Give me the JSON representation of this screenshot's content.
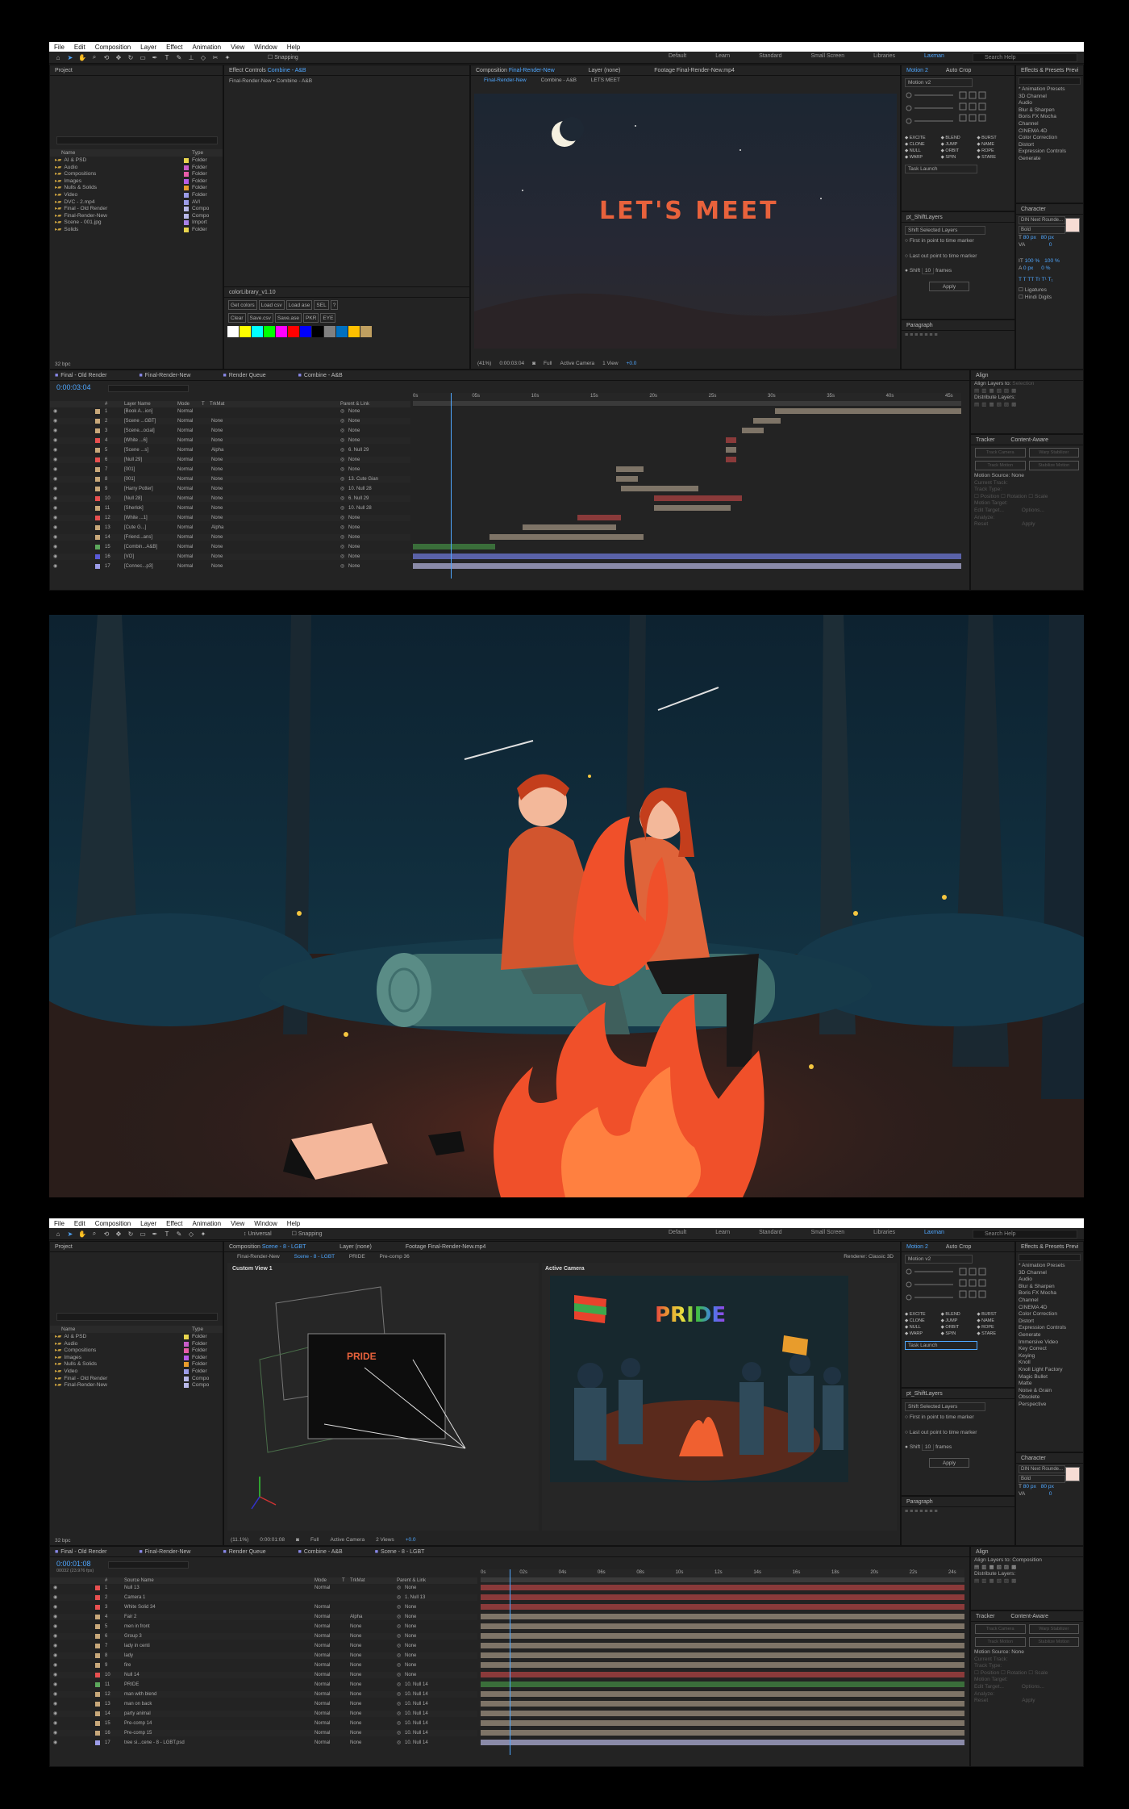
{
  "menu": [
    "File",
    "Edit",
    "Composition",
    "Layer",
    "Effect",
    "Animation",
    "View",
    "Window",
    "Help"
  ],
  "workspaces": [
    "Default",
    "Learn",
    "Standard",
    "Small Screen",
    "Libraries",
    "Laxman"
  ],
  "search_placeholder": "Search Help",
  "snapping": "Snapping",
  "top": {
    "project_title": "Project",
    "project_cols": [
      "Name",
      "Type"
    ],
    "project_items": [
      {
        "name": "AI & PSD",
        "type": "Folder",
        "color": "#e8d44d"
      },
      {
        "name": "Audio",
        "type": "Folder",
        "color": "#c85cc8"
      },
      {
        "name": "Compositions",
        "type": "Folder",
        "color": "#e85ca8"
      },
      {
        "name": "Images",
        "type": "Folder",
        "color": "#b85ce8"
      },
      {
        "name": "Nulls & Solids",
        "type": "Folder",
        "color": "#e89c2c"
      },
      {
        "name": "Video",
        "type": "Folder",
        "color": "#9c9ce8"
      },
      {
        "name": "DVC - 2.mp4",
        "type": "AVI",
        "color": "#9c9ce8"
      },
      {
        "name": "Final - Old Render",
        "type": "Compo",
        "color": "#b8b8e8"
      },
      {
        "name": "Final-Render-New",
        "type": "Compo",
        "color": "#b8b8e8"
      },
      {
        "name": "Scene - 001.jpg",
        "type": "Import",
        "color": "#a880e8"
      },
      {
        "name": "Solids",
        "type": "Folder",
        "color": "#e8d44d"
      }
    ],
    "bpc": "32 bpc",
    "effect_controls_tab": "Effect Controls",
    "effect_controls_target": "Combine - A&B",
    "effect_controls_path": "Final-Render-New • Combine - A&B",
    "colorlib_title": "colorLibrary_v1.10",
    "colorlib_buttons_1": [
      "Get colors",
      "Load csv",
      "Load ase",
      "SEL",
      "?"
    ],
    "colorlib_buttons_2": [
      "Clear",
      "Save.csv",
      "Save.ase",
      "PKR",
      "EYE"
    ],
    "swatches": [
      "#ffffff",
      "#ffff00",
      "#00ffff",
      "#00ff00",
      "#ff00ff",
      "#ff0000",
      "#0000ff",
      "#000000",
      "#808080",
      "#0070c0",
      "#ffc000",
      "#c0a060"
    ],
    "comp_tab": "Composition",
    "comp_name": "Final-Render-New",
    "layer_tab": "Layer (none)",
    "footage_tab": "Footage Final-Render-New.mp4",
    "breadcrumbs": [
      "Final-Render-New",
      "Combine - A&B",
      "LETS MEET"
    ],
    "viewer_text": "LET'S MEET",
    "zoom": "(41%)",
    "timecode_small": "0:00:03:04",
    "resolution": "Full",
    "camera": "Active Camera",
    "views": "1 View",
    "exposure": "+0.0",
    "motion_tabs": [
      "Motion 2",
      "Auto Crop"
    ],
    "motion_version": "Motion v2",
    "motion_buttons": [
      "EXCITE",
      "BLEND",
      "BURST",
      "CLONE",
      "JUMP",
      "NAME",
      "NULL",
      "ORBIT",
      "ROPE",
      "WARP",
      "SPIN",
      "STARE"
    ],
    "task_launch": "Task Launch",
    "shift_title": "pt_ShiftLayers",
    "shift_mode": "Shift Selected Layers",
    "shift_opt1": "First in point to time marker",
    "shift_opt2": "Last out point to time marker",
    "shift_label": "Shift",
    "shift_value": "10",
    "shift_unit": "frames",
    "apply": "Apply",
    "paragraph": "Paragraph",
    "effects_tabs": [
      "Effects & Presets",
      "Previ"
    ],
    "effects_list": [
      "* Animation Presets",
      "3D Channel",
      "Audio",
      "Blur & Sharpen",
      "Boris FX Mocha",
      "Channel",
      "CINEMA 4D",
      "Color Correction",
      "Distort",
      "Expression Controls",
      "Generate"
    ],
    "character_title": "Character",
    "font_name": "DIN Next Rounde...",
    "font_style": "Bold",
    "font_size": "80 px",
    "leading": "80 px",
    "tracking_val": "0",
    "scale_v": "100 %",
    "scale_h": "100 %",
    "baseline": "0 px",
    "tsume": "0 %",
    "ligatures": "Ligatures",
    "hindi_digits": "Hindi Digits",
    "align_title": "Align",
    "align_layers_to": "Align Layers to:",
    "align_target": "Selection",
    "distribute": "Distribute Layers:",
    "tracker_tabs": [
      "Tracker",
      "Content-Aware"
    ],
    "tracker_buttons": [
      "Track Camera",
      "Warp Stabilizer",
      "Track Motion",
      "Stabilize Motion"
    ],
    "motion_source": "Motion Source:",
    "motion_source_val": "None",
    "current_track": "Current Track:",
    "track_type": "Track Type:",
    "track_opts": [
      "Position",
      "Rotation",
      "Scale"
    ],
    "motion_target": "Motion Target:",
    "edit_target": "Edit Target...",
    "options": "Options...",
    "analyze": "Analyze:",
    "reset": "Reset",
    "apply2": "Apply",
    "timeline_tabs": [
      "Final - Old Render",
      "Final-Render-New",
      "Render Queue",
      "Combine - A&B"
    ],
    "timecode": "0:00:03:04",
    "tl_cols": [
      "#",
      "Layer Name",
      "Mode",
      "T",
      "TrkMat",
      "Parent & Link"
    ],
    "ruler": [
      "0s",
      "05s",
      "10s",
      "15s",
      "20s",
      "25s",
      "30s",
      "35s",
      "40s",
      "45s"
    ],
    "layers": [
      {
        "n": "1",
        "name": "[Book A...ion]",
        "mode": "Normal",
        "trk": "",
        "parent": "None",
        "color": "#c8a87a"
      },
      {
        "n": "2",
        "name": "[Scene ...GBT]",
        "mode": "Normal",
        "trk": "None",
        "parent": "None",
        "color": "#c8a87a"
      },
      {
        "n": "3",
        "name": "[Scene...ocial]",
        "mode": "Normal",
        "trk": "None",
        "parent": "None",
        "color": "#c8a87a"
      },
      {
        "n": "4",
        "name": "[White ...6]",
        "mode": "Normal",
        "trk": "None",
        "parent": "None",
        "color": "#e85050"
      },
      {
        "n": "5",
        "name": "[Scene ...s]",
        "mode": "Normal",
        "trk": "Alpha",
        "parent": "6. Null 29",
        "color": "#c8a87a"
      },
      {
        "n": "6",
        "name": "[Null 29]",
        "mode": "Normal",
        "trk": "None",
        "parent": "None",
        "color": "#e85050"
      },
      {
        "n": "7",
        "name": "[001]",
        "mode": "Normal",
        "trk": "None",
        "parent": "None",
        "color": "#c8a87a"
      },
      {
        "n": "8",
        "name": "[001]",
        "mode": "Normal",
        "trk": "None",
        "parent": "13. Cute Gian",
        "color": "#c8a87a"
      },
      {
        "n": "9",
        "name": "[Harry Potter]",
        "mode": "Normal",
        "trk": "None",
        "parent": "10. Null 28",
        "color": "#c8a87a"
      },
      {
        "n": "10",
        "name": "[Null 28]",
        "mode": "Normal",
        "trk": "None",
        "parent": "6. Null 29",
        "color": "#e85050"
      },
      {
        "n": "11",
        "name": "[Sherlok]",
        "mode": "Normal",
        "trk": "None",
        "parent": "10. Null 28",
        "color": "#c8a87a"
      },
      {
        "n": "12",
        "name": "[White ...1]",
        "mode": "Normal",
        "trk": "None",
        "parent": "None",
        "color": "#e85050"
      },
      {
        "n": "13",
        "name": "[Cute G...]",
        "mode": "Normal",
        "trk": "Alpha",
        "parent": "None",
        "color": "#c8a87a"
      },
      {
        "n": "14",
        "name": "[Friend...ans]",
        "mode": "Normal",
        "trk": "None",
        "parent": "None",
        "color": "#c8a87a"
      },
      {
        "n": "15",
        "name": "[Combin...A&B]",
        "mode": "Normal",
        "trk": "None",
        "parent": "None",
        "color": "#5ca85c"
      },
      {
        "n": "16",
        "name": "[VO]",
        "mode": "Normal",
        "trk": "None",
        "parent": "None",
        "color": "#5a5ad8"
      },
      {
        "n": "17",
        "name": "[Connec...p3]",
        "mode": "Normal",
        "trk": "None",
        "parent": "None",
        "color": "#9c9ce8"
      }
    ]
  },
  "bottom": {
    "project_title": "Project",
    "project_items": [
      {
        "name": "AI & PSD",
        "type": "Folder",
        "color": "#e8d44d"
      },
      {
        "name": "Audio",
        "type": "Folder",
        "color": "#c85cc8"
      },
      {
        "name": "Compositions",
        "type": "Folder",
        "color": "#e85ca8"
      },
      {
        "name": "Images",
        "type": "Folder",
        "color": "#b85ce8"
      },
      {
        "name": "Nulls & Solids",
        "type": "Folder",
        "color": "#e89c2c"
      },
      {
        "name": "Video",
        "type": "Folder",
        "color": "#9c9ce8"
      },
      {
        "name": "Final - Old Render",
        "type": "Compo",
        "color": "#b8b8e8"
      },
      {
        "name": "Final-Render-New",
        "type": "Compo",
        "color": "#b8b8e8"
      }
    ],
    "bpc": "32 bpc",
    "comp_tab": "Composition",
    "comp_name": "Scene - 8 - LGBT",
    "layer_tab": "Layer (none)",
    "footage_tab": "Footage Final-Render-New.mp4",
    "breadcrumbs": [
      "Final-Render-New",
      "Scene - 8 - LGBT",
      "PRIDE",
      "Pre-comp 36"
    ],
    "renderer": "Renderer:",
    "renderer_val": "Classic 3D",
    "custom_view": "Custom View 1",
    "active_camera_label": "Active Camera",
    "pride": "PRIDE",
    "zoom": "(11.1%)",
    "timecode_small": "0:00:01:08",
    "resolution": "Full",
    "camera": "Active Camera",
    "views": "2 Views",
    "exposure": "+0.0",
    "universal": "Universal",
    "effects_list": [
      "* Animation Presets",
      "3D Channel",
      "Audio",
      "Blur & Sharpen",
      "Boris FX Mocha",
      "Channel",
      "CINEMA 4D",
      "Color Correction",
      "Distort",
      "Expression Controls",
      "Generate",
      "Immersive Video",
      "Key Correct",
      "Keying",
      "Knoll",
      "Knoll Light Factory",
      "Magic Bullet",
      "Matte",
      "Noise & Grain",
      "Obsolete",
      "Perspective"
    ],
    "align_target": "Composition",
    "timeline_tabs": [
      "Final - Old Render",
      "Final-Render-New",
      "Render Queue",
      "Combine - A&B",
      "Scene - 8 - LGBT"
    ],
    "timecode": "0:00:01:08",
    "frames": "00032 (23.976 fps)",
    "tl_cols": [
      "#",
      "Source Name",
      "Mode",
      "T",
      "TrkMat",
      "Parent & Link"
    ],
    "ruler": [
      "0s",
      "02s",
      "04s",
      "06s",
      "08s",
      "10s",
      "12s",
      "14s",
      "16s",
      "18s",
      "20s",
      "22s",
      "24s"
    ],
    "layers": [
      {
        "n": "1",
        "name": "Null 13",
        "mode": "Normal",
        "trk": "",
        "parent": "None",
        "color": "#e85050"
      },
      {
        "n": "2",
        "name": "Camera 1",
        "mode": "",
        "trk": "",
        "parent": "1. Null 13",
        "color": "#e85050"
      },
      {
        "n": "3",
        "name": "White Solid 34",
        "mode": "Normal",
        "trk": "",
        "parent": "None",
        "color": "#e85050"
      },
      {
        "n": "4",
        "name": "Fair 2",
        "mode": "Normal",
        "trk": "Alpha",
        "parent": "None",
        "color": "#c8a87a"
      },
      {
        "n": "5",
        "name": "men in front",
        "mode": "Normal",
        "trk": "None",
        "parent": "None",
        "color": "#c8a87a"
      },
      {
        "n": "6",
        "name": "Group 3",
        "mode": "Normal",
        "trk": "None",
        "parent": "None",
        "color": "#c8a87a"
      },
      {
        "n": "7",
        "name": "lady in centi",
        "mode": "Normal",
        "trk": "None",
        "parent": "None",
        "color": "#c8a87a"
      },
      {
        "n": "8",
        "name": "lady",
        "mode": "Normal",
        "trk": "None",
        "parent": "None",
        "color": "#c8a87a"
      },
      {
        "n": "9",
        "name": "fire",
        "mode": "Normal",
        "trk": "None",
        "parent": "None",
        "color": "#c8a87a"
      },
      {
        "n": "10",
        "name": "Null 14",
        "mode": "Normal",
        "trk": "None",
        "parent": "None",
        "color": "#e85050"
      },
      {
        "n": "11",
        "name": "PRIDE",
        "mode": "Normal",
        "trk": "None",
        "parent": "10. Null 14",
        "color": "#5ca85c"
      },
      {
        "n": "12",
        "name": "man with blend",
        "mode": "Normal",
        "trk": "None",
        "parent": "10. Null 14",
        "color": "#c8a87a"
      },
      {
        "n": "13",
        "name": "man on back",
        "mode": "Normal",
        "trk": "None",
        "parent": "10. Null 14",
        "color": "#c8a87a"
      },
      {
        "n": "14",
        "name": "party animal",
        "mode": "Normal",
        "trk": "None",
        "parent": "10. Null 14",
        "color": "#c8a87a"
      },
      {
        "n": "15",
        "name": "Pre-comp 14",
        "mode": "Normal",
        "trk": "None",
        "parent": "10. Null 14",
        "color": "#c8a87a"
      },
      {
        "n": "16",
        "name": "Pre-comp 15",
        "mode": "Normal",
        "trk": "None",
        "parent": "10. Null 14",
        "color": "#c8a87a"
      },
      {
        "n": "17",
        "name": "tree si...cene - 8 - LGBT.psd",
        "mode": "Normal",
        "trk": "None",
        "parent": "10. Null 14",
        "color": "#9c9ce8"
      }
    ]
  },
  "colors": {
    "accent": "#4fa7ff",
    "panel": "#232323",
    "bg": "#1d1d1d",
    "layer_bar": "#7e7467",
    "text_orange": "#e8623c"
  }
}
